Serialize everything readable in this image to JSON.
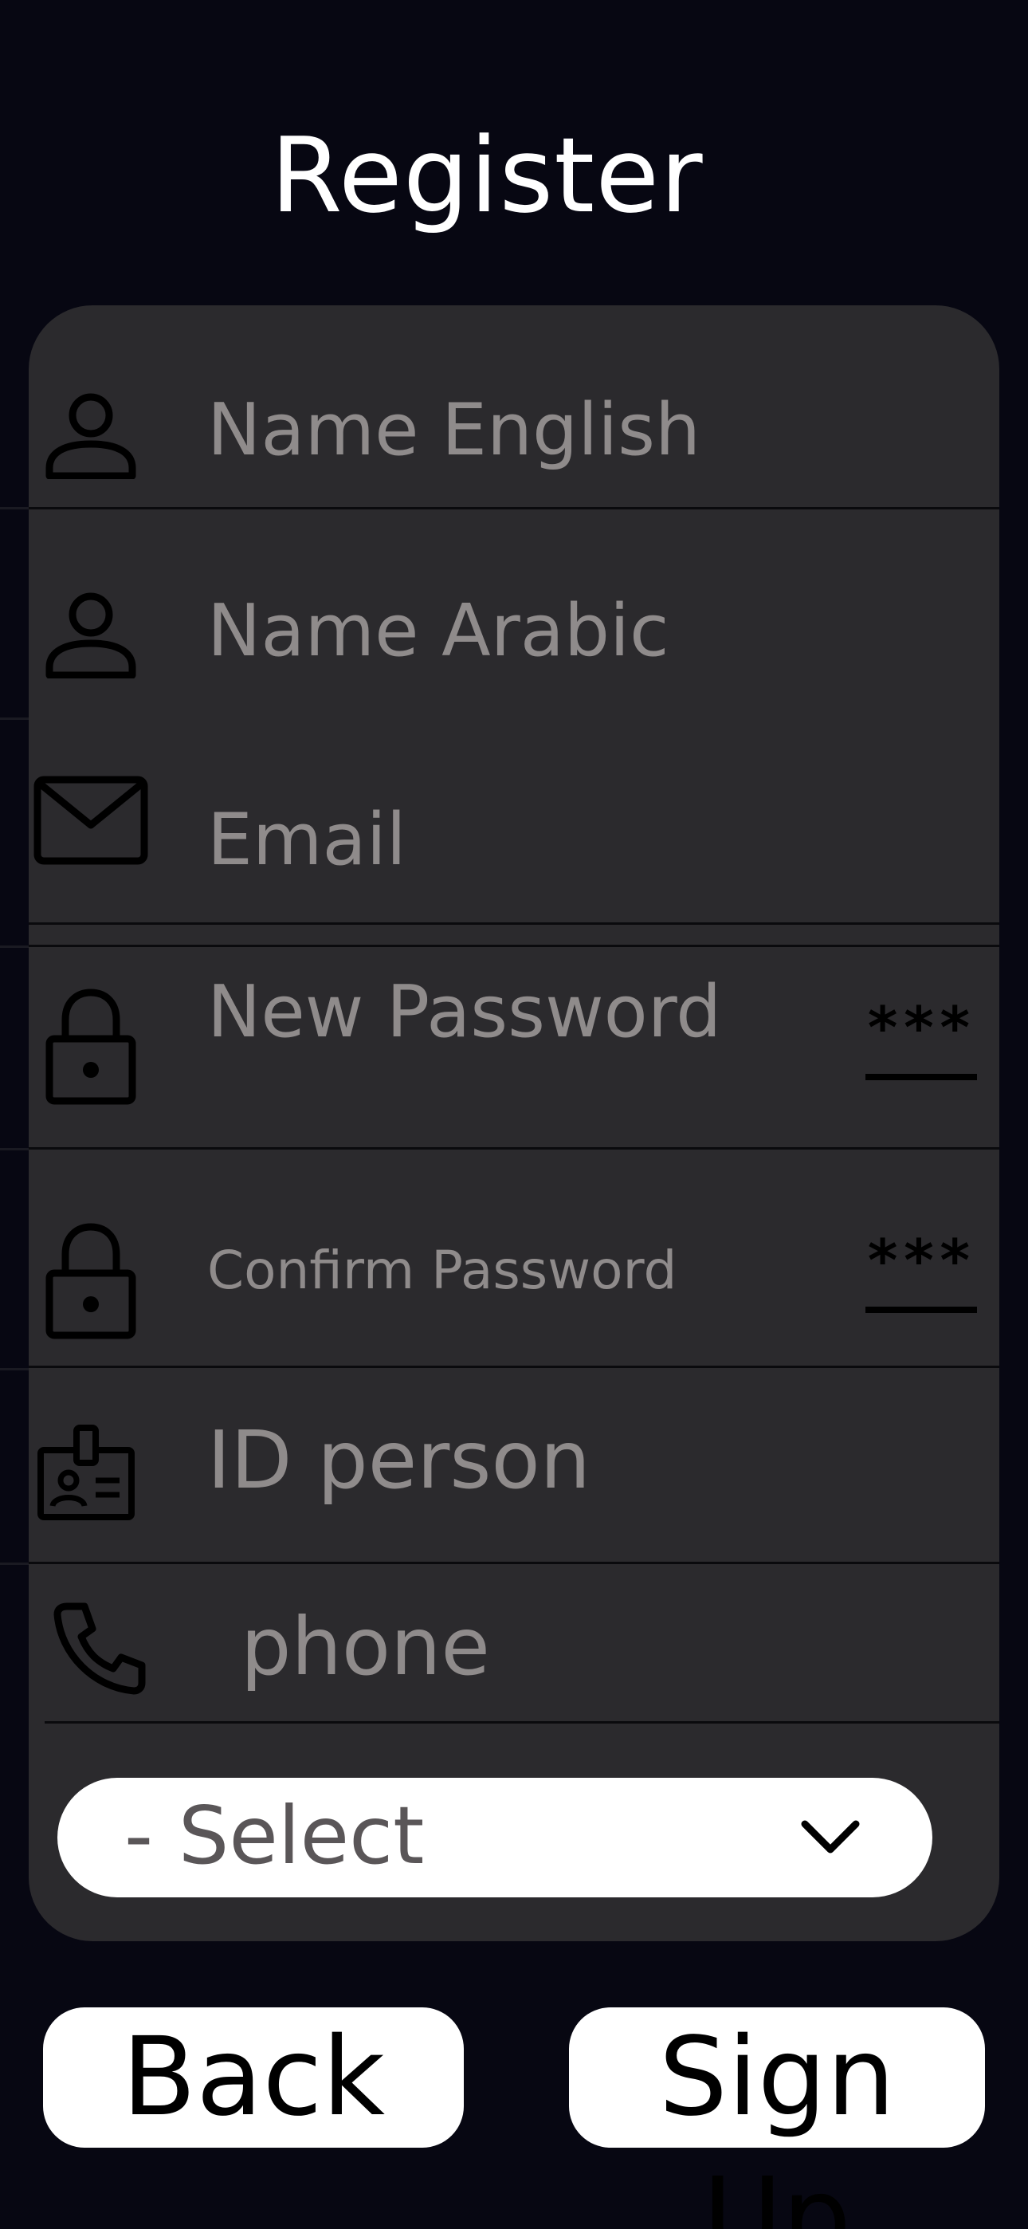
{
  "header": {
    "title": "Register"
  },
  "form": {
    "name_english": {
      "placeholder": "Name English",
      "icon": "person-icon"
    },
    "name_arabic": {
      "placeholder": "Name Arabic",
      "icon": "person-icon"
    },
    "email": {
      "placeholder": "Email",
      "icon": "envelope-icon"
    },
    "new_password": {
      "placeholder": "New Password",
      "icon": "lock-icon",
      "toggle": "***"
    },
    "confirm_password": {
      "placeholder": "Confirm Password",
      "icon": "lock-icon",
      "toggle": "***"
    },
    "id_person": {
      "placeholder": "ID person",
      "icon": "id-badge-icon"
    },
    "phone": {
      "placeholder": "phone",
      "icon": "phone-icon"
    },
    "select": {
      "value": "- Select",
      "icon": "chevron-down-icon"
    }
  },
  "actions": {
    "back_label": "Back",
    "signup_label": "Sign Up"
  },
  "colors": {
    "background": "#070712",
    "card": "#2b2a2d",
    "placeholder": "#8f8b8b",
    "button": "#ffffff"
  }
}
